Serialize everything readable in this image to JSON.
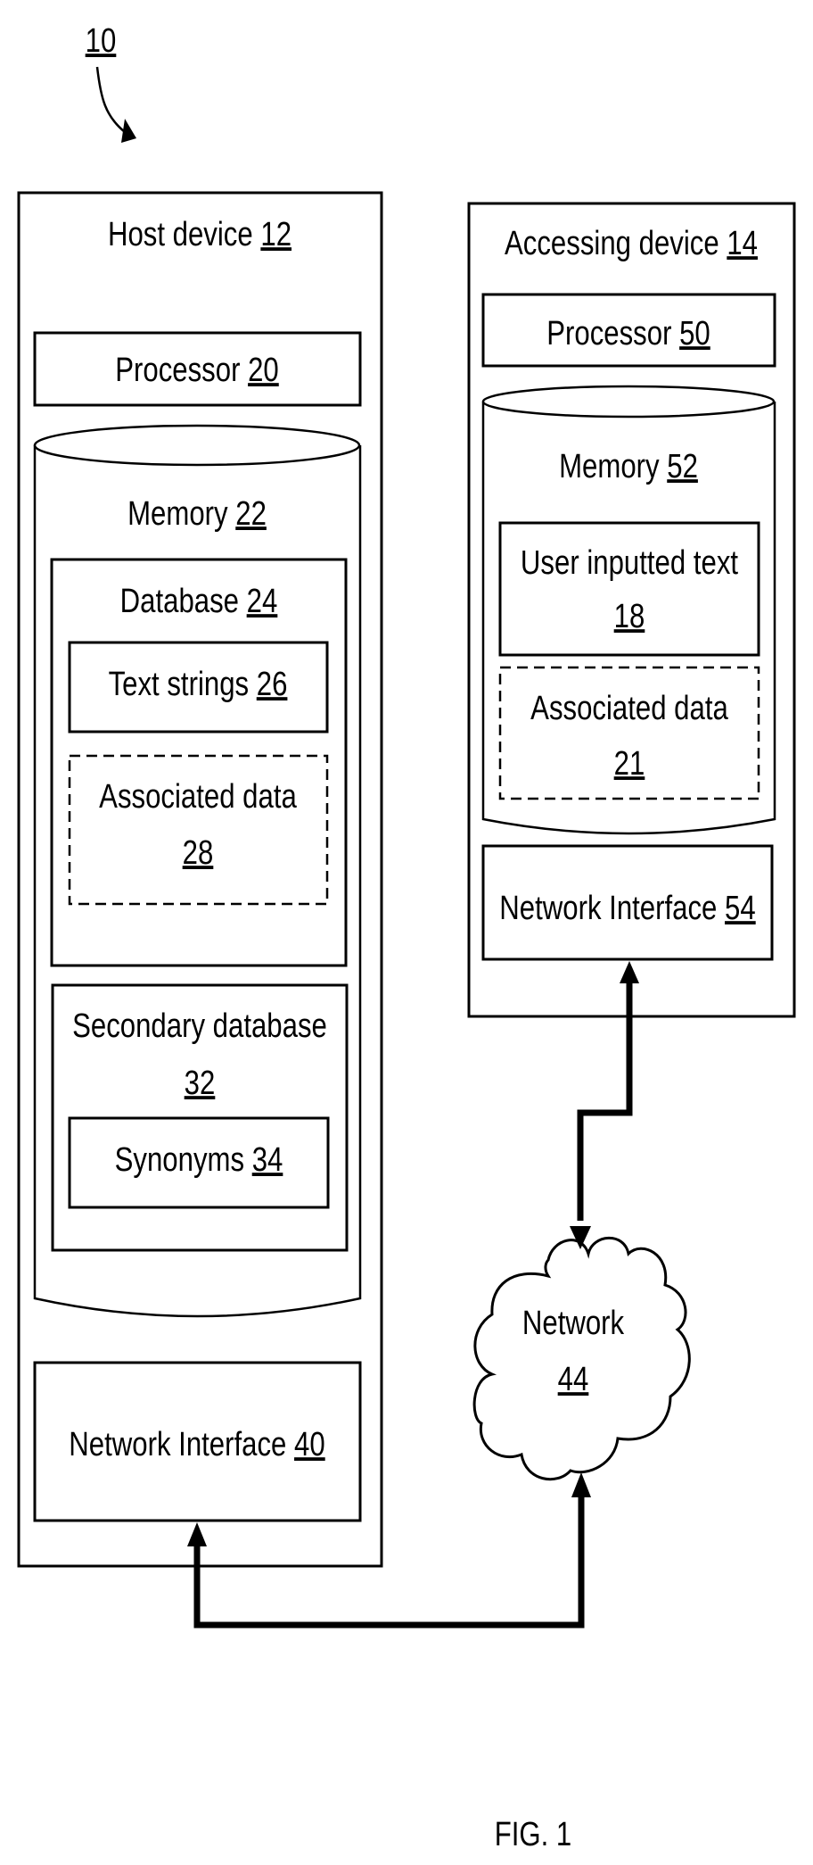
{
  "figure": {
    "reference_label": "10",
    "caption": "FIG. 1"
  },
  "host": {
    "title": "Host device",
    "title_ref": "12",
    "processor": {
      "label": "Processor",
      "ref": "20"
    },
    "memory": {
      "label": "Memory",
      "ref": "22"
    },
    "database": {
      "label": "Database",
      "ref": "24"
    },
    "text_strings": {
      "label": "Text strings",
      "ref": "26"
    },
    "associated_data": {
      "label": "Associated data",
      "ref": "28"
    },
    "secondary_database": {
      "label": "Secondary database",
      "ref": "32"
    },
    "synonyms": {
      "label": "Synonyms",
      "ref": "34"
    },
    "network_interface": {
      "label": "Network Interface",
      "ref": "40"
    }
  },
  "accessing": {
    "title": "Accessing device",
    "title_ref": "14",
    "processor": {
      "label": "Processor",
      "ref": "50"
    },
    "memory": {
      "label": "Memory",
      "ref": "52"
    },
    "user_text": {
      "label": "User inputted text",
      "ref": "18"
    },
    "associated_data": {
      "label": "Associated data",
      "ref": "21"
    },
    "network_interface": {
      "label": "Network Interface",
      "ref": "54"
    }
  },
  "network": {
    "label": "Network",
    "ref": "44"
  }
}
